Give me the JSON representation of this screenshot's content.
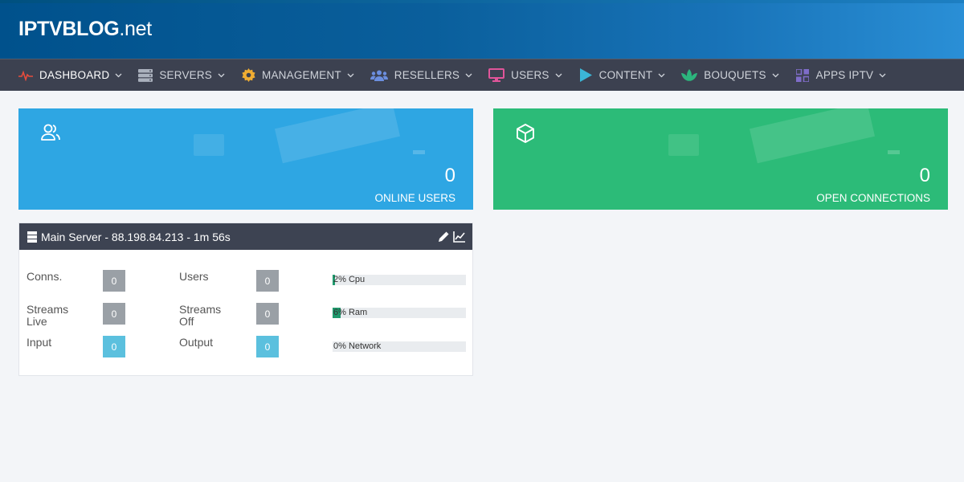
{
  "header": {
    "brand_bold": "IPTVBLOG",
    "brand_rest": ".net"
  },
  "nav": [
    {
      "label": "DASHBOARD",
      "icon": "pulse-icon",
      "color": "#e74c3c"
    },
    {
      "label": "SERVERS",
      "icon": "server-icon",
      "color": "#aab1bd"
    },
    {
      "label": "MANAGEMENT",
      "icon": "gear-icon",
      "color": "#f0ad32"
    },
    {
      "label": "RESELLERS",
      "icon": "users-group-icon",
      "color": "#6c8fe0"
    },
    {
      "label": "USERS",
      "icon": "monitor-icon",
      "color": "#e0559a"
    },
    {
      "label": "CONTENT",
      "icon": "play-icon",
      "color": "#3bb6d6"
    },
    {
      "label": "BOUQUETS",
      "icon": "lotus-icon",
      "color": "#2cb67d"
    },
    {
      "label": "APPS IPTV",
      "icon": "apps-grid-icon",
      "color": "#7f6dc9"
    }
  ],
  "cards": {
    "online_users": {
      "value": "0",
      "label": "ONLINE USERS",
      "icon": "users-icon",
      "color": "#2ea6e3"
    },
    "open_connections": {
      "value": "0",
      "label": "OPEN CONNECTIONS",
      "icon": "cube-icon",
      "color": "#2cbb78"
    }
  },
  "server": {
    "title": "Main Server - 88.198.84.213 - 1m 56s",
    "stats": {
      "conns_label": "Conns.",
      "conns_value": "0",
      "users_label": "Users",
      "users_value": "0",
      "streams_live_label": "Streams Live",
      "streams_live_value": "0",
      "streams_off_label": "Streams Off",
      "streams_off_value": "0",
      "input_label": "Input",
      "input_value": "0",
      "output_label": "Output",
      "output_value": "0"
    },
    "bars": {
      "cpu_text": "2% Cpu",
      "cpu_percent": 2,
      "ram_text": "6% Ram",
      "ram_percent": 6,
      "network_text": "0% Network",
      "network_percent": 0
    }
  }
}
